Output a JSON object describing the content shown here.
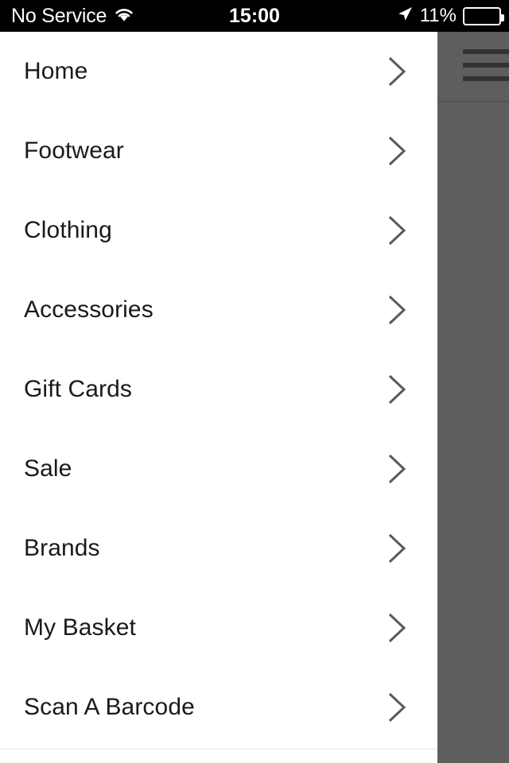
{
  "status_bar": {
    "carrier": "No Service",
    "wifi_icon": "wifi-icon",
    "time": "15:00",
    "location_icon": "location-arrow-icon",
    "battery_percent": "11%",
    "battery_level": 11,
    "battery_color": "#f12a1c",
    "background": "#000000",
    "foreground": "#ffffff"
  },
  "drawer": {
    "background": "#ffffff",
    "items": [
      {
        "label": "Home",
        "chevron": "chevron-right-icon"
      },
      {
        "label": "Footwear",
        "chevron": "chevron-right-icon"
      },
      {
        "label": "Clothing",
        "chevron": "chevron-right-icon"
      },
      {
        "label": "Accessories",
        "chevron": "chevron-right-icon"
      },
      {
        "label": "Gift Cards",
        "chevron": "chevron-right-icon"
      },
      {
        "label": "Sale",
        "chevron": "chevron-right-icon"
      },
      {
        "label": "Brands",
        "chevron": "chevron-right-icon"
      },
      {
        "label": "My Basket",
        "chevron": "chevron-right-icon"
      },
      {
        "label": "Scan A Barcode",
        "chevron": "chevron-right-icon"
      }
    ]
  },
  "content_panel": {
    "overlay_color": "#5e5e5e",
    "menu_icon": "hamburger-menu-icon"
  }
}
